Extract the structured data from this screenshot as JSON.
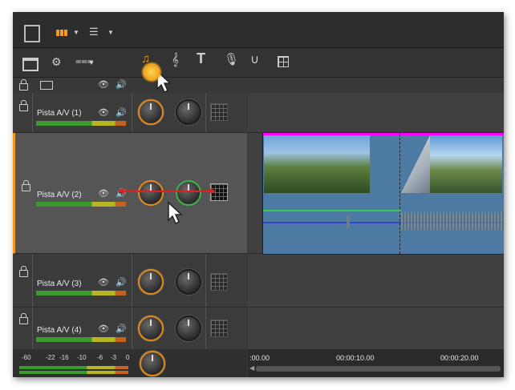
{
  "colors": {
    "accent": "#f29a1c",
    "selection": "#ff00ff",
    "audio_line": "#33cc55",
    "volume_line": "#3344cc",
    "link_arrow": "#e02020"
  },
  "topbar": {
    "icons": [
      "library-icon",
      "grid-view-icon",
      "list-view-icon"
    ]
  },
  "toolbar": {
    "icons": [
      "storyboard-icon",
      "settings-icon",
      "snap-icon",
      "audio-mixer-icon",
      "music-icon",
      "title-icon",
      "microphone-icon",
      "scorefitter-icon",
      "montage-icon"
    ]
  },
  "tracks": [
    {
      "name": "Pista A/V (1)",
      "selected": false
    },
    {
      "name": "Pista A/V (2)",
      "selected": true
    },
    {
      "name": "Pista A/V (3)",
      "selected": false
    },
    {
      "name": "Pista A/V (4)",
      "selected": false
    }
  ],
  "meter_scale": {
    "labels": [
      "-60",
      "-22",
      "-16",
      "-10",
      "-6",
      "-3",
      "0"
    ]
  },
  "ruler": {
    "labels": [
      ":00.00",
      "00:00:10.00",
      "00:00:20.00"
    ]
  }
}
